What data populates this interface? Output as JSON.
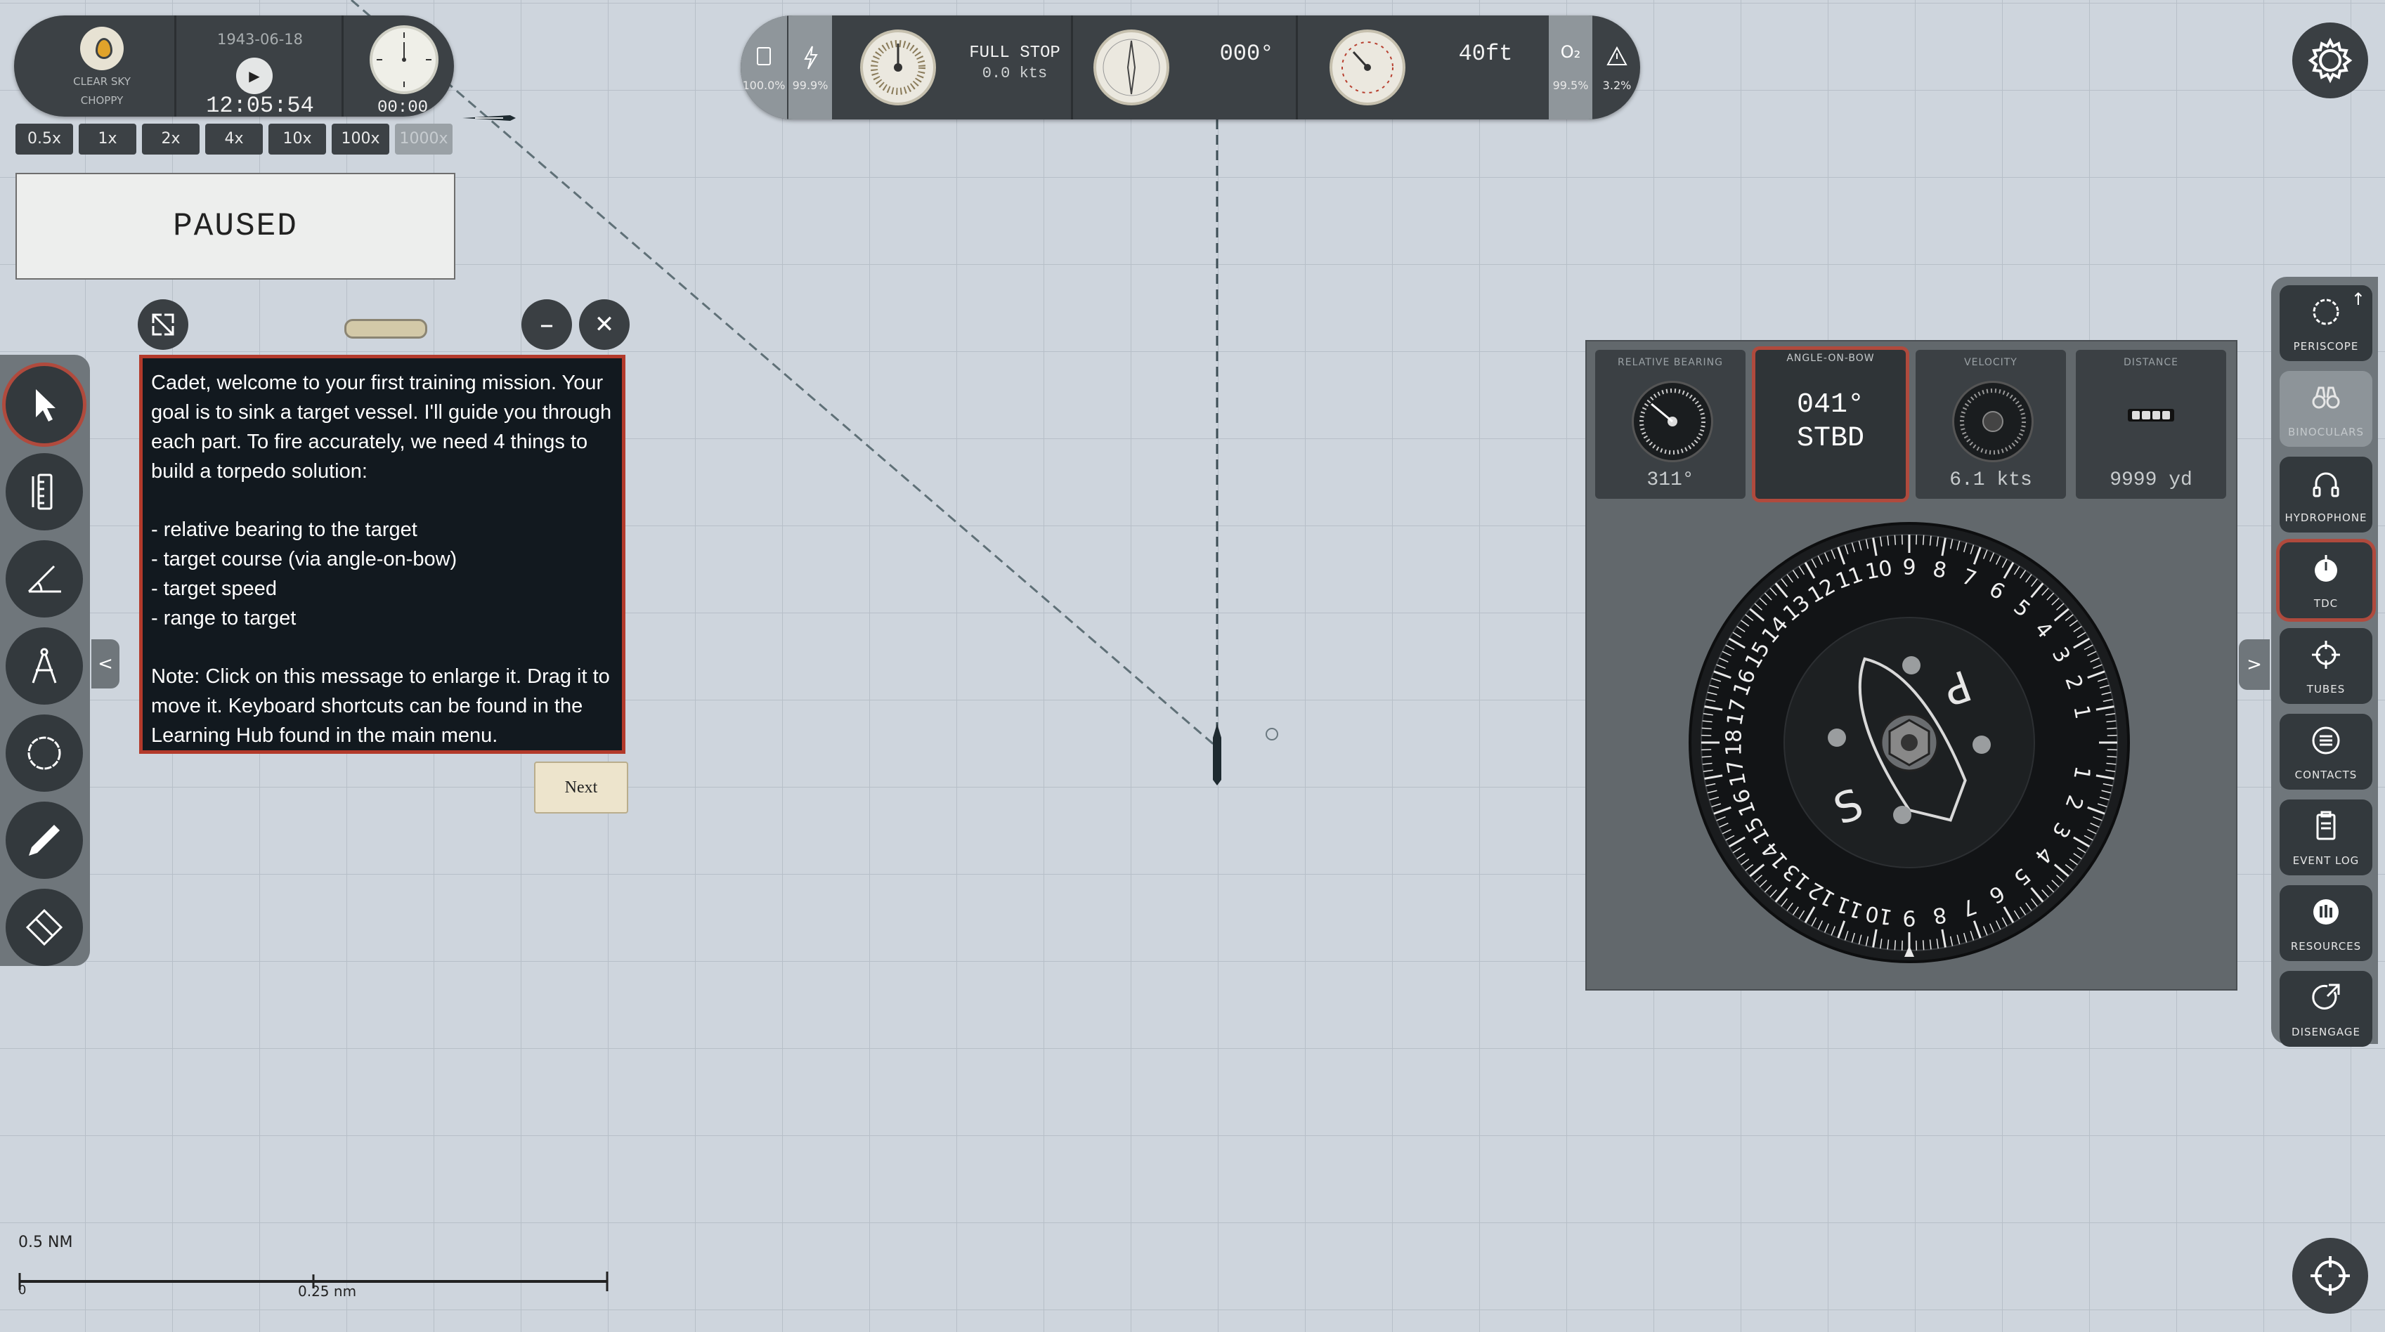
{
  "time_panel": {
    "weather_line1": "CLEAR SKY",
    "weather_line2": "CHOPPY",
    "date": "1943-06-18",
    "play_icon": "▶",
    "clock": "12:05:54",
    "stopwatch": "00:00"
  },
  "speed_buttons": [
    "0.5x",
    "1x",
    "2x",
    "4x",
    "10x",
    "100x",
    "1000x"
  ],
  "paused_label": "PAUSED",
  "message": {
    "minimize": "–",
    "close": "✕",
    "para1": "Cadet, welcome to your first training mission. Your goal is to sink a target vessel. I'll guide you through each part. To fire accurately, we need 4 things to build a torpedo solution:",
    "para2": "- relative bearing to the target\n- target course (via angle-on-bow)\n- target speed\n- range to target",
    "para3": "Note: Click on this message to enlarge it. Drag it to move it. Keyboard shortcuts can be found in the Learning Hub found in the main menu.",
    "next_label": "Next"
  },
  "left_toolbar": {
    "collapse_label": "<",
    "tools": [
      "select-tool",
      "ruler-tool",
      "protractor-tool",
      "compass-tool",
      "circle-tool",
      "pencil-tool",
      "eraser-tool"
    ]
  },
  "status_bar": {
    "fuel_pct": "100.0%",
    "battery_pct": "99.9%",
    "engine_order": "FULL STOP",
    "speed": "0.0 kts",
    "heading": "000°",
    "depth": "40ft",
    "oxygen_label": "O₂",
    "oxygen_pct": "99.5%",
    "hull_damage_pct": "3.2%"
  },
  "tdc": {
    "relative_bearing_title": "RELATIVE BEARING",
    "relative_bearing_value": "311°",
    "aob_title": "ANGLE-ON-BOW",
    "aob_value_deg": "041°",
    "aob_value_side": "STBD",
    "velocity_title": "VELOCITY",
    "velocity_value": "6.1 kts",
    "distance_title": "DISTANCE",
    "distance_value": "9999 yd",
    "dial_letter_top": "P",
    "dial_letter_bottom": "S",
    "dial_numbers": [
      "1",
      "2",
      "3",
      "4",
      "5",
      "6",
      "7",
      "8",
      "9",
      "10",
      "11",
      "12",
      "13",
      "14",
      "15",
      "16",
      "17",
      "18",
      "17",
      "16",
      "15",
      "14",
      "13",
      "12",
      "11",
      "10",
      "9",
      "8",
      "7",
      "6",
      "5",
      "4",
      "3",
      "2",
      "1"
    ]
  },
  "right_bar": {
    "collapse_label": ">",
    "items": [
      "PERISCOPE",
      "BINOCULARS",
      "HYDROPHONE",
      "TDC",
      "TUBES",
      "CONTACTS",
      "EVENT LOG",
      "RESOURCES",
      "DISENGAGE"
    ],
    "periscope_arrow": "↑"
  },
  "scale": {
    "title": "0.5 NM",
    "start": "0",
    "mid": "0.25 nm"
  },
  "colors": {
    "map_background": "#ced5dd",
    "panel_dark": "#3c4145",
    "accent_red": "#b04a3d",
    "message_bg": "#12191f"
  }
}
